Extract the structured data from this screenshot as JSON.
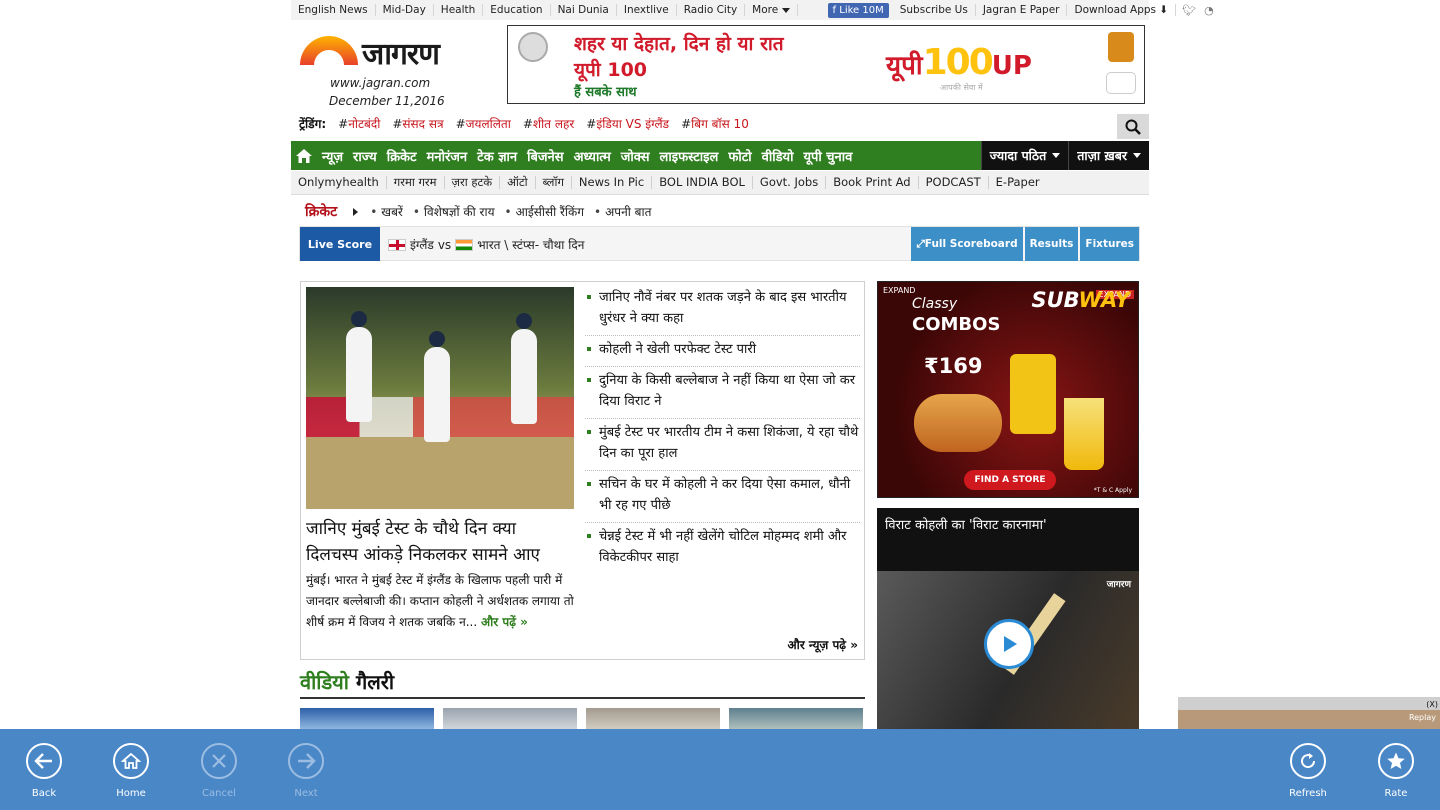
{
  "top_links": [
    "English News",
    "Mid-Day",
    "Health",
    "Education",
    "Nai Dunia",
    "Inextlive",
    "Radio City",
    "More"
  ],
  "fb_like": "Like 10M",
  "top_right_links": [
    "Subscribe Us",
    "Jagran E Paper",
    "Download Apps"
  ],
  "header": {
    "logo_text": "जागरण",
    "url": "www.jagran.com",
    "date": "December 11,2016"
  },
  "banner": {
    "line1": "शहर या देहात, दिन हो या रात",
    "line2": "यूपी 100",
    "line3": "हैं सबके साथ",
    "brand_prefix": "यूपी",
    "brand_number": "100",
    "brand_suffix": "UP",
    "tagline": "आपकी सेवा में"
  },
  "trending": {
    "label": "ट्रेंडिंग:",
    "tags": [
      "नोटबंदी",
      "संसद सत्र",
      "जयललिता",
      "शीत लहर",
      "इंडिया VS इंग्लैंड",
      "बिग बॉस 10"
    ]
  },
  "nav": {
    "items": [
      "न्यूज़",
      "राज्य",
      "क्रिकेट",
      "मनोरंजन",
      "टेक ज्ञान",
      "बिजनेस",
      "अध्यात्म",
      "जोक्स",
      "लाइफस्टाइल",
      "फोटो",
      "वीडियो",
      "यूपी चुनाव"
    ],
    "dropdowns": [
      "ज्यादा पठित",
      "ताज़ा ख़बर"
    ]
  },
  "subnav": [
    "Onlymyhealth",
    "गरमा गरम",
    "ज़रा हटके",
    "ऑटो",
    "ब्लॉग",
    "News In Pic",
    "BOL INDIA BOL",
    "Govt. Jobs",
    "Book Print Ad",
    "PODCAST",
    "E-Paper"
  ],
  "cricket": {
    "title": "क्रिकेट",
    "items": [
      "खबरें",
      "विशेषज्ञों की राय",
      "आईसीसी रैंकिंग",
      "अपनी बात"
    ]
  },
  "live_score": {
    "label": "Live Score",
    "team1": "इंग्लैंड",
    "vs": "vs",
    "team2": "भारत \\ स्टंप्स- चौथा दिन",
    "buttons": [
      "Full Scoreboard",
      "Results",
      "Fixtures"
    ]
  },
  "main_story": {
    "title": "जानिए मुंबई टेस्ट के चौथे दिन क्या दिलचस्प आंकड़े निकलकर सामने आए",
    "body": "मुंबई। भारत ने मुंबई टेस्ट में इंग्लैंड के खिलाफ पहली पारी में जानदार बल्लेबाजी की। कप्तान कोहली ने अर्धशतक लगाया तो शीर्ष क्रम में विजय ने शतक जबकि न...",
    "read_more": "और पढ़ें »",
    "list": [
      "जानिए नौवें नंबर पर शतक जड़ने के बाद इस भारतीय धुरंधर ने क्या कहा",
      "कोहली ने खेली परफेक्ट टेस्ट पारी",
      "दुनिया के किसी बल्लेबाज ने नहीं किया था ऐसा जो कर दिया विराट ने",
      "मुंबई टेस्ट पर भारतीय टीम ने कसा शिकंजा, ये रहा चौथे दिन का पूरा हाल",
      "सचिन के घर में कोहली ने कर दिया ऐसा कमाल, धौनी भी रह गए पीछे",
      "चेन्नई टेस्ट में भी नहीं खेलेंगे चोटिल मोहम्मद शमी और विकेटकीपर साहा"
    ],
    "more_news": "और न्यूज़ पढ़े »"
  },
  "video_gallery": {
    "title_part1": "वीडियो",
    "title_part2": "गैलरी"
  },
  "ad_subway": {
    "expand": "EXPAND",
    "classy": "Classy",
    "combos": "COMBOS",
    "brand_sub": "SUB",
    "brand_way": "WAY",
    "price": "₹169",
    "cta": "FIND A STORE",
    "tc": "*T & C Apply"
  },
  "video_card": {
    "title": "विराट कोहली का 'विराट कारनामा'",
    "watermark": "जागरण"
  },
  "corner_ad": {
    "close": "(X)",
    "replay": "Replay"
  },
  "app_bar": {
    "left": [
      {
        "label": "Back",
        "icon": "back-arrow-icon",
        "enabled": true
      },
      {
        "label": "Home",
        "icon": "home-icon",
        "enabled": true
      },
      {
        "label": "Cancel",
        "icon": "close-icon",
        "enabled": false
      },
      {
        "label": "Next",
        "icon": "forward-arrow-icon",
        "enabled": false
      }
    ],
    "right": [
      {
        "label": "Refresh",
        "icon": "refresh-icon",
        "enabled": true
      },
      {
        "label": "Rate",
        "icon": "star-icon",
        "enabled": true
      }
    ]
  },
  "colors": {
    "nav_green": "#2f7e1f",
    "app_bar_blue": "#4a87c7",
    "live_score_blue": "#1c5aa6",
    "accent_red": "#c8161d"
  }
}
